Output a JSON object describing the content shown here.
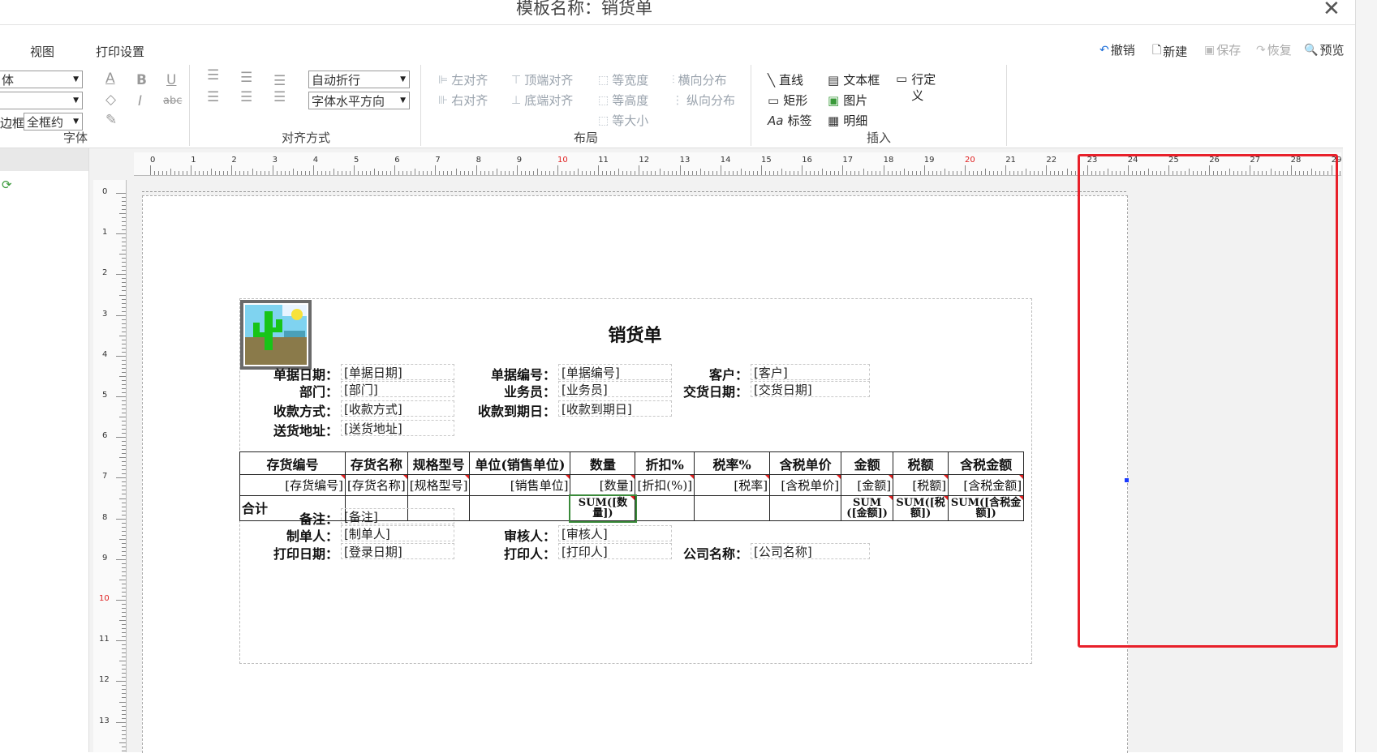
{
  "window": {
    "title": "模板名称：销货单"
  },
  "menu": {
    "view": "视图",
    "print_settings": "打印设置"
  },
  "actions": {
    "undo": "撤销",
    "new": "新建",
    "save": "保存",
    "redo": "恢复",
    "preview": "预览"
  },
  "ribbon": {
    "font": {
      "font_name_value": "体",
      "font_size_value": "",
      "border_label": "边框",
      "border_value": "全框约",
      "bold": "B",
      "italic": "I",
      "underline": "U",
      "strike": "abc",
      "color": "A",
      "group_label": "字体"
    },
    "align": {
      "wrap_value": "自动折行",
      "direction_value": "字体水平方向",
      "group_label": "对齐方式"
    },
    "layout": {
      "left_align": "左对齐",
      "right_align": "右对齐",
      "top_align": "顶端对齐",
      "bottom_align": "底端对齐",
      "same_width": "等宽度",
      "same_height": "等高度",
      "same_size": "等大小",
      "h_distribute": "横向分布",
      "v_distribute": "纵向分布",
      "group_label": "布局"
    },
    "insert": {
      "line": "直线",
      "rect": "矩形",
      "label": "标签",
      "textbox": "文本框",
      "image": "图片",
      "detail": "明细",
      "custom_row": "行定义",
      "group_label": "插入"
    }
  },
  "rulers": {
    "h_numbers": [
      "0",
      "1",
      "2",
      "3",
      "4",
      "5",
      "6",
      "7",
      "8",
      "9",
      "10",
      "11",
      "12",
      "13",
      "14",
      "15",
      "16",
      "17",
      "18",
      "19",
      "20",
      "21",
      "22",
      "23",
      "24",
      "25",
      "26",
      "27",
      "28",
      "29"
    ],
    "v_numbers": [
      "0",
      "1",
      "2",
      "3",
      "4",
      "5",
      "6",
      "7",
      "8",
      "9",
      "10",
      "11",
      "12",
      "13"
    ],
    "highlight_color": "#e02020"
  },
  "report": {
    "title": "销货单",
    "fields": {
      "doc_date_label": "单据日期：",
      "doc_date_value": "[单据日期]",
      "doc_no_label": "单据编号：",
      "doc_no_value": "[单据编号]",
      "customer_label": "客户：",
      "customer_value": "[客户]",
      "dept_label": "部门：",
      "dept_value": "[部门]",
      "salesman_label": "业务员：",
      "salesman_value": "[业务员]",
      "delivery_date_label": "交货日期：",
      "delivery_date_value": "[交货日期]",
      "pay_method_label": "收款方式：",
      "pay_method_value": "[收款方式]",
      "pay_due_label": "收款到期日：",
      "pay_due_value": "[收款到期日]",
      "address_label": "送货地址：",
      "address_value": "[送货地址]",
      "remark_label": "备注：",
      "remark_value": "[备注]",
      "maker_label": "制单人：",
      "maker_value": "[制单人]",
      "auditor_label": "审核人：",
      "auditor_value": "[审核人]",
      "print_date_label": "打印日期：",
      "print_date_value": "[登录日期]",
      "printer_label": "打印人：",
      "printer_value": "[打印人]",
      "company_label": "公司名称：",
      "company_value": "[公司名称]"
    },
    "table": {
      "headers": [
        "存货编号",
        "存货名称",
        "规格型号",
        "单位(销售单位)",
        "数量",
        "折扣%",
        "税率%",
        "含税单价",
        "金额",
        "税额",
        "含税金额"
      ],
      "row": [
        "[存货编号]",
        "[存货名称]",
        "[规格型号]",
        "[销售单位]",
        "[数量]",
        "[折扣(%)]",
        "[税率]",
        "[含税单价]",
        "[金额]",
        "[税额]",
        "[含税金额]"
      ],
      "sum_label": "合计",
      "sums": [
        "",
        "",
        "",
        "",
        "SUM([数量])",
        "",
        "",
        "",
        "SUM([金额])",
        "SUM([税额])",
        "SUM([含税金额])"
      ]
    }
  }
}
